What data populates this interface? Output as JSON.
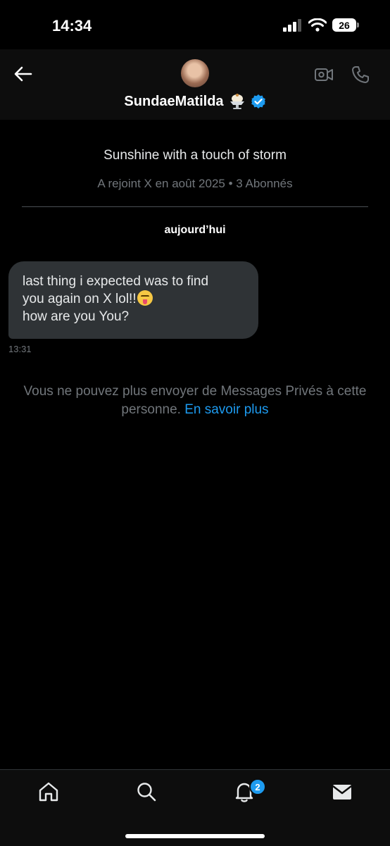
{
  "status_bar": {
    "time": "14:34",
    "battery_level": "26"
  },
  "header": {
    "name": "SundaeMatilda",
    "icons": [
      "back-arrow-icon",
      "avatar",
      "ice-cream-emoji-icon",
      "verified-badge-icon",
      "video-call-icon",
      "phone-call-icon"
    ]
  },
  "profile": {
    "bio": "Sunshine with a touch of storm",
    "meta": "A rejoint X en août 2025 • 3 Abonnés"
  },
  "conversation": {
    "day_label": "aujourd’hui",
    "message": {
      "line1": "last thing i expected was to find",
      "line2": "you again on X lol!!",
      "line3": "how are you  You?",
      "time": "13:31"
    }
  },
  "notice": {
    "text": "Vous ne pouvez plus envoyer de Messages Privés à cette personne.",
    "link": "En savoir plus"
  },
  "bottom_nav": {
    "notifications_badge": "2"
  },
  "colors": {
    "accent": "#1d9bf0",
    "bubble": "#2f3336",
    "muted": "#71767b",
    "background": "#000000"
  }
}
